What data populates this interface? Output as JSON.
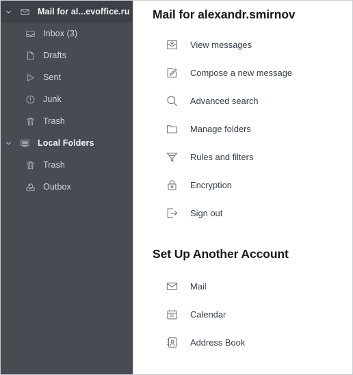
{
  "sidebar": {
    "items": [
      {
        "label": "Mail for al...evoffice.ru",
        "icon": "envelope-icon",
        "level": 0,
        "twisty": "chevron-down-icon",
        "selected": true
      },
      {
        "label": "Inbox (3)",
        "icon": "inbox-tray-icon",
        "level": 1,
        "twisty": null,
        "selected": false
      },
      {
        "label": "Drafts",
        "icon": "document-icon",
        "level": 1,
        "twisty": null,
        "selected": false
      },
      {
        "label": "Sent",
        "icon": "send-triangle-icon",
        "level": 1,
        "twisty": null,
        "selected": false
      },
      {
        "label": "Junk",
        "icon": "junk-octagon-icon",
        "level": 1,
        "twisty": null,
        "selected": false
      },
      {
        "label": "Trash",
        "icon": "trash-icon",
        "level": 1,
        "twisty": null,
        "selected": false
      },
      {
        "label": "Local Folders",
        "icon": "monitor-icon",
        "level": 0,
        "twisty": "chevron-down-icon",
        "selected": false
      },
      {
        "label": "Trash",
        "icon": "trash-icon",
        "level": 1,
        "twisty": null,
        "selected": false
      },
      {
        "label": "Outbox",
        "icon": "outbox-tray-icon",
        "level": 1,
        "twisty": null,
        "selected": false
      }
    ]
  },
  "main": {
    "account_title": "Mail for alexandr.smirnov",
    "account_actions": [
      {
        "label": "View messages",
        "icon": "inbox-download-icon"
      },
      {
        "label": "Compose a new message",
        "icon": "compose-pencil-icon"
      },
      {
        "label": "Advanced search",
        "icon": "search-icon"
      },
      {
        "label": "Manage folders",
        "icon": "folder-icon"
      },
      {
        "label": "Rules and filters",
        "icon": "filter-funnel-icon"
      },
      {
        "label": "Encryption",
        "icon": "lock-icon"
      },
      {
        "label": "Sign out",
        "icon": "sign-out-icon"
      }
    ],
    "setup_title": "Set Up Another Account",
    "setup_actions": [
      {
        "label": "Mail",
        "icon": "envelope-icon"
      },
      {
        "label": "Calendar",
        "icon": "calendar-icon"
      },
      {
        "label": "Address Book",
        "icon": "address-book-icon"
      }
    ]
  },
  "colors": {
    "sidebar_background": "#474b52",
    "sidebar_selected": "#3d4147",
    "sidebar_text": "#d6d9dd",
    "main_background": "#ffffff",
    "main_title_text": "#16181c",
    "main_item_text": "#363d49",
    "main_icon": "#6d737c",
    "window_border": "#c9ccd1"
  }
}
